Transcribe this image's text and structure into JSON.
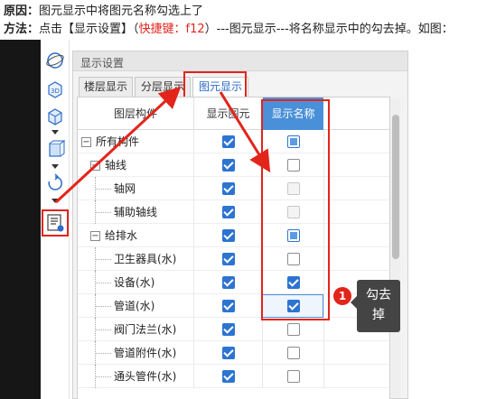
{
  "instructions": {
    "cause_label": "原因：",
    "cause_text": "图元显示中将图元名称勾选上了",
    "method_label": "方法：",
    "method_pre": "点击【显示设置】（",
    "shortcut": "快捷键：f12",
    "method_post": "）---图元显示---将名称显示中的勾去掉。如图："
  },
  "toolbar": {
    "tools": [
      {
        "icon": "globe-icon"
      },
      {
        "icon": "view-3d-icon",
        "label": "3D"
      },
      {
        "icon": "cube-icon"
      },
      {
        "icon": "box-icon"
      },
      {
        "icon": "rotate-icon"
      },
      {
        "icon": "display-settings-icon"
      }
    ]
  },
  "dialog": {
    "title": "显示设置",
    "tabs": [
      "楼层显示",
      "分层显示",
      "图元显示"
    ],
    "active_tab": "图元显示",
    "columns": {
      "component": "图层构件",
      "show": "显示图元",
      "name": "显示名称"
    },
    "rows": [
      {
        "label": "所有构件",
        "level": 0,
        "expander": "−",
        "show": "checked",
        "name": "partial"
      },
      {
        "label": "轴线",
        "level": 1,
        "expander": "−",
        "show": "checked",
        "name": "empty"
      },
      {
        "label": "轴网",
        "level": 2,
        "show": "checked",
        "name": "disabled"
      },
      {
        "label": "辅助轴线",
        "level": 2,
        "show": "checked",
        "name": "disabled"
      },
      {
        "label": "给排水",
        "level": 1,
        "expander": "−",
        "show": "checked",
        "name": "partial"
      },
      {
        "label": "卫生器具(水)",
        "level": 2,
        "show": "checked",
        "name": "empty"
      },
      {
        "label": "设备(水)",
        "level": 2,
        "show": "checked",
        "name": "checked"
      },
      {
        "label": "管道(水)",
        "level": 2,
        "show": "checked",
        "name": "checked",
        "highlight": true
      },
      {
        "label": "阀门法兰(水)",
        "level": 2,
        "show": "checked",
        "name": "empty"
      },
      {
        "label": "管道附件(水)",
        "level": 2,
        "show": "checked",
        "name": "empty"
      },
      {
        "label": "通头管件(水)",
        "level": 2,
        "show": "checked",
        "name": "empty"
      }
    ]
  },
  "annotation": {
    "badge": "1",
    "callout_line1": "勾去",
    "callout_line2": "掉"
  },
  "colors": {
    "highlight_red": "#e3241b",
    "checkbox_blue": "#2d74d1",
    "header_blue": "#4a90d9"
  }
}
